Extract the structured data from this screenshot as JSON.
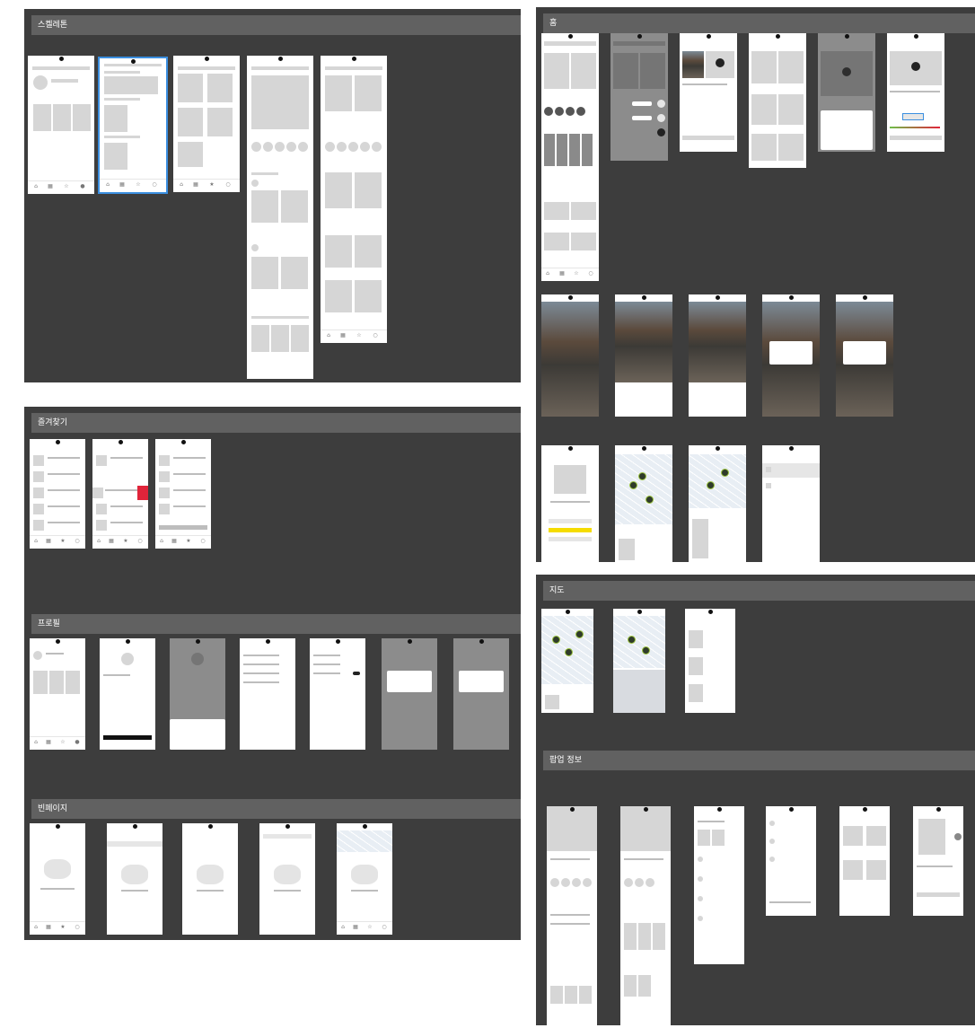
{
  "sections": {
    "skeleton": {
      "title": "스켈레톤"
    },
    "home": {
      "title": "홈"
    },
    "favorites": {
      "title": "즐겨찾기"
    },
    "profile": {
      "title": "프로필"
    },
    "empty": {
      "title": "빈페이지"
    },
    "map": {
      "title": "지도"
    },
    "popup": {
      "title": "팝업 정보"
    }
  },
  "colors": {
    "canvas": "#ffffff",
    "section_bg": "#3d3d3d",
    "section_header": "#616161",
    "selection": "#3b8fe0",
    "danger": "#e0243a",
    "kakao": "#f5dc00"
  }
}
